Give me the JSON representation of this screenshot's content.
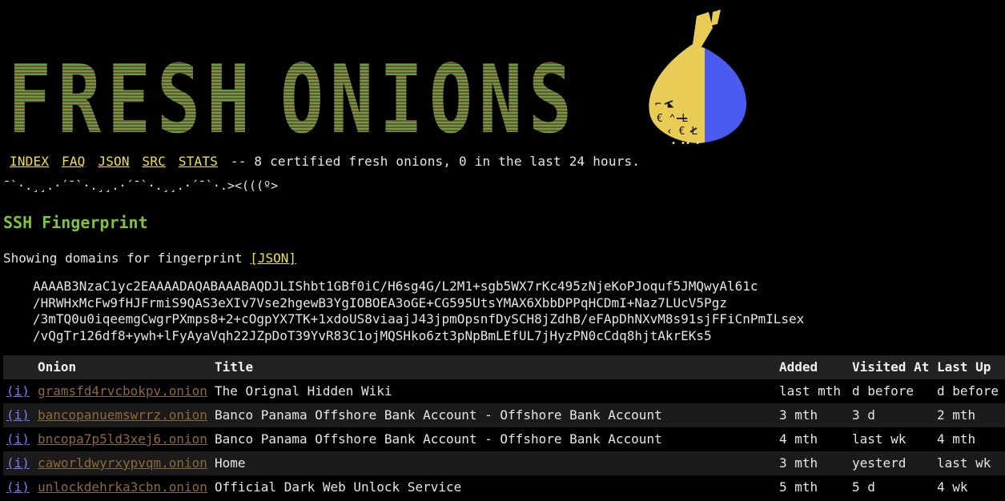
{
  "banner": {
    "letters": [
      "F",
      "R",
      "E",
      "S",
      "H",
      " ",
      "O",
      "N",
      "I",
      "O",
      "N",
      "S"
    ],
    "logo_alt": "onion logo",
    "colors": {
      "letter_green": "#5aa83a",
      "letter_dark": "#7a4a3a",
      "onion_yellow": "#e8cc55",
      "onion_blue": "#4a5cf0"
    }
  },
  "nav": {
    "links": [
      "INDEX",
      "FAQ",
      "JSON",
      "SRC",
      "STATS"
    ],
    "tagline": "-- 8 certified fresh onions, 0 in the last 24 hours."
  },
  "fish_art": "¯`·.¸¸.·´¯`·.¸¸.·´¯`·.¸¸.·´¯`·.><(((º>",
  "section_title": "SSH Fingerprint",
  "showing": {
    "text": "Showing domains for fingerprint",
    "json_link": "[JSON]"
  },
  "fingerprint_lines": [
    "AAAAB3NzaC1yc2EAAAADAQABAAABAQDJLIShbt1GBf0iC/H6sg4G/L2M1+sgb5WX7rKc495zNjeKoPJoquf5JMQwyAl61c",
    "/HRWHxMcFw9fHJFrmiS9QAS3eXIv7Vse2hgewB3YgIOBOEA3oGE+CG595UtsYMAX6XbbDPPqHCDmI+Naz7LUcV5Pgz",
    "/3mTQ0u0iqeemgCwgrPXmps8+2+cOgpYX7TK+1xdoUS8viaajJ43jpmOpsnfDySCH8jZdhB/eFApDhNXvM8s91sjFFiCnPmILsex",
    "/vQgTr126df8+ywh+lFyAyaVqh22JZpDoT39YvR83C1ojMQSHko6zt3pNpBmLEfUL7jHyzPN0cCdq8hjtAkrEKs5"
  ],
  "table": {
    "headers": [
      "",
      "Onion",
      "Title",
      "Added",
      "Visited At",
      "Last Up"
    ],
    "rows": [
      {
        "info": "(i)",
        "onion": "gramsfd4rvcbokpv.onion",
        "title": "The Orignal Hidden Wiki",
        "added": "last mth",
        "visited": "d before",
        "last_up": "d before"
      },
      {
        "info": "(i)",
        "onion": "bancopanuemswrrz.onion",
        "title": "Banco Panama Offshore Bank Account - Offshore Bank Account",
        "added": "3 mth",
        "visited": "3 d",
        "last_up": "2 mth"
      },
      {
        "info": "(i)",
        "onion": "bncopa7p5ld3xej6.onion",
        "title": "Banco Panama Offshore Bank Account - Offshore Bank Account",
        "added": "4 mth",
        "visited": "last wk",
        "last_up": "4 mth"
      },
      {
        "info": "(i)",
        "onion": "caworldwyrxypvqm.onion",
        "title": "Home",
        "added": "3 mth",
        "visited": "yesterd",
        "last_up": "last wk"
      },
      {
        "info": "(i)",
        "onion": "unlockdehrka3cbn.onion",
        "title": "Official Dark Web Unlock Service",
        "added": "5 mth",
        "visited": "5 d",
        "last_up": "4 wk"
      }
    ]
  }
}
